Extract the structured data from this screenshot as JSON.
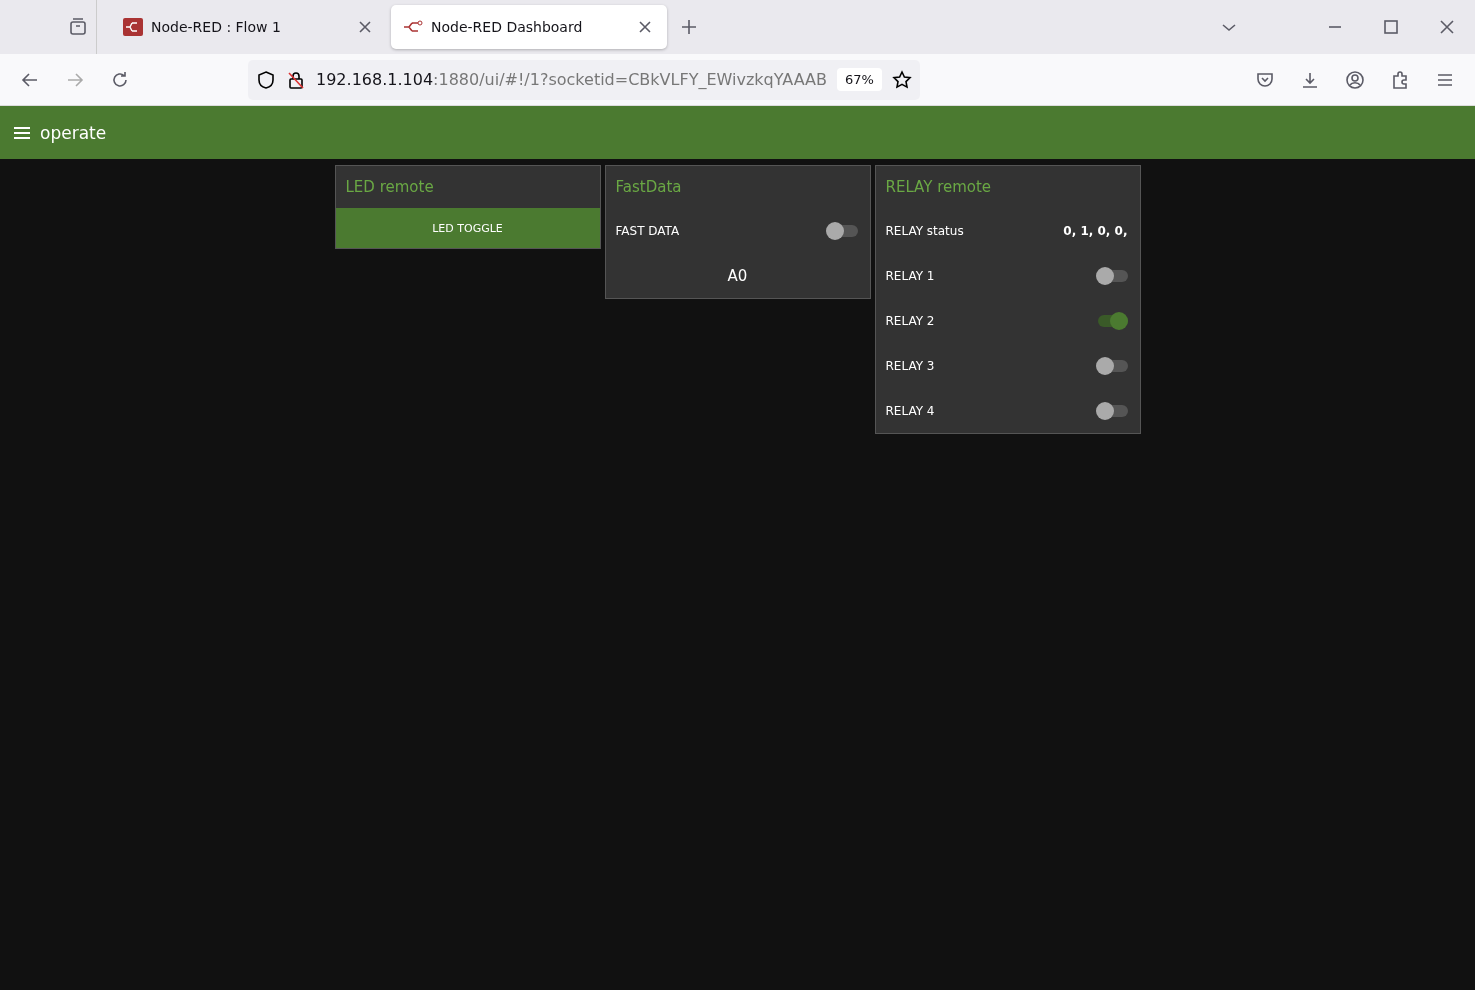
{
  "browser": {
    "tabs": [
      {
        "title": "Node-RED : Flow 1",
        "selected": false
      },
      {
        "title": "Node-RED Dashboard",
        "selected": true
      }
    ],
    "url": {
      "host": "192.168.1.104",
      "rest": ":1880/ui/#!/1?socketid=CBkVLFY_EWivzkqYAAAB"
    },
    "zoom": "67%"
  },
  "toolbar": {
    "title": "operate"
  },
  "groups": [
    {
      "title": "LED remote",
      "widgets": [
        {
          "kind": "button",
          "label": "LED TOGGLE"
        }
      ]
    },
    {
      "title": "FastData",
      "widgets": [
        {
          "kind": "switch",
          "label": "FAST DATA",
          "on": false
        },
        {
          "kind": "text",
          "label": "A0"
        }
      ]
    },
    {
      "title": "RELAY remote",
      "widgets": [
        {
          "kind": "value",
          "label": "RELAY status",
          "value": "0, 1, 0, 0,"
        },
        {
          "kind": "switch",
          "label": "RELAY 1",
          "on": false
        },
        {
          "kind": "switch",
          "label": "RELAY 2",
          "on": true
        },
        {
          "kind": "switch",
          "label": "RELAY 3",
          "on": false
        },
        {
          "kind": "switch",
          "label": "RELAY 4",
          "on": false
        }
      ]
    }
  ]
}
